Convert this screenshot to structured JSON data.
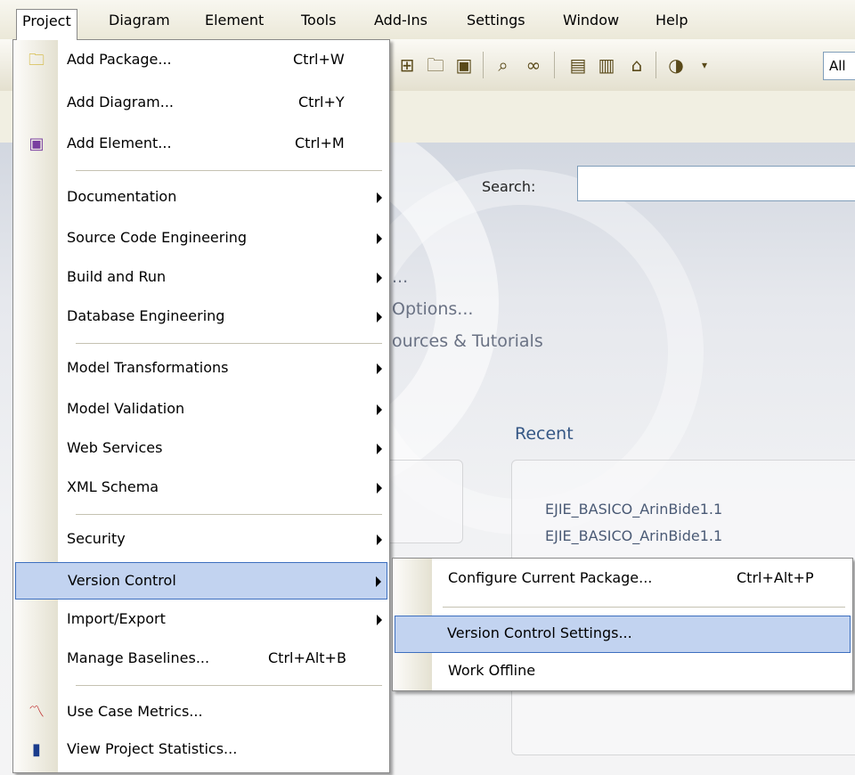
{
  "menubar": {
    "items": [
      {
        "label": "Project",
        "mn": "P",
        "rest": "roject",
        "active": true
      },
      {
        "label": "Diagram",
        "mn": "D",
        "rest": "iagram"
      },
      {
        "label": "Element",
        "pre": "Ele",
        "mn": "m",
        "post": "ent"
      },
      {
        "label": "Tools",
        "mn": "T",
        "rest": "ools"
      },
      {
        "label": "Add-Ins",
        "mn": "A",
        "rest": "dd-Ins"
      },
      {
        "label": "Settings",
        "mn": "S",
        "rest": "ettings"
      },
      {
        "label": "Window",
        "mn": "W",
        "rest": "indow"
      },
      {
        "label": "Help",
        "mn": "H",
        "rest": "elp"
      }
    ]
  },
  "toolbar": {
    "filter_value": "All",
    "icons": [
      "diagram-icon",
      "new-package-icon",
      "new-element-icon",
      "find-icon",
      "binoculars-icon",
      "document-icon",
      "book-icon",
      "browse-icon",
      "eye-icon",
      "overflow-icon"
    ]
  },
  "startpage": {
    "search_label": "Search:",
    "fragment_1": "...",
    "fragment_2": "Options...",
    "fragment_3": "ources & Tutorials",
    "recent_title": "Recent",
    "recent_items": [
      "EJIE_BASICO_ArinBide1.1",
      "EJIE_BASICO_ArinBide1.1"
    ]
  },
  "project_menu": {
    "items": [
      {
        "label": "Add Package...",
        "shortcut": "Ctrl+W",
        "icon": "add-package-icon"
      },
      {
        "label": "Add Diagram...",
        "shortcut": "Ctrl+Y"
      },
      {
        "label": "Add Element...",
        "shortcut": "Ctrl+M",
        "icon": "add-element-icon"
      },
      {
        "label": "Documentation",
        "submenu": true
      },
      {
        "label": "Source Code Engineering",
        "submenu": true
      },
      {
        "label": "Build and Run",
        "submenu": true
      },
      {
        "label": "Database Engineering",
        "submenu": true
      },
      {
        "label": "Model Transformations",
        "submenu": true
      },
      {
        "label": "Model Validation",
        "submenu": true
      },
      {
        "label": "Web Services",
        "submenu": true
      },
      {
        "label": "XML Schema",
        "submenu": true
      },
      {
        "label": "Security",
        "submenu": true
      },
      {
        "label": "Version Control",
        "submenu": true,
        "highlighted": true
      },
      {
        "label": "Import/Export",
        "submenu": true
      },
      {
        "label": "Manage Baselines...",
        "shortcut": "Ctrl+Alt+B"
      },
      {
        "label": "Use Case Metrics...",
        "icon": "metrics-chart-icon"
      },
      {
        "label": "View Project Statistics...",
        "icon": "statistics-bar-icon"
      }
    ]
  },
  "version_control_menu": {
    "items": [
      {
        "label": "Configure Current Package...",
        "shortcut": "Ctrl+Alt+P"
      },
      {
        "label": "Version Control Settings...",
        "highlighted": true
      },
      {
        "label": "Work Offline"
      }
    ]
  }
}
